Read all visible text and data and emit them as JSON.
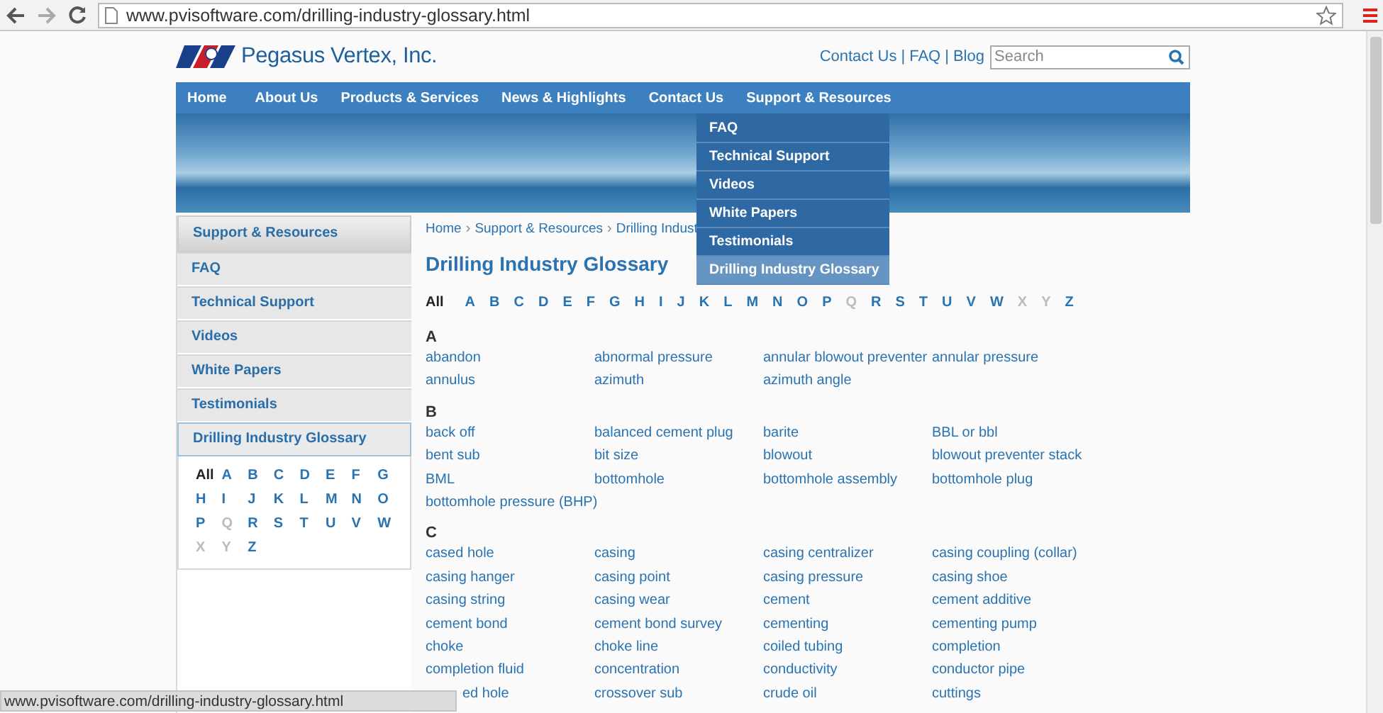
{
  "browser": {
    "url": "www.pvisoftware.com/drilling-industry-glossary.html"
  },
  "header": {
    "logo_text": "Pegasus Vertex, Inc.",
    "top_links": [
      "Contact Us",
      "FAQ",
      "Blog"
    ],
    "link_separator": "|",
    "search": {
      "placeholder": "Search"
    }
  },
  "nav": [
    "Home",
    "About Us",
    "Products & Services",
    "News & Highlights",
    "Contact Us",
    "Support & Resources"
  ],
  "dropdown": [
    {
      "label": "FAQ",
      "selected": false
    },
    {
      "label": "Technical Support",
      "selected": false
    },
    {
      "label": "Videos",
      "selected": false
    },
    {
      "label": "White Papers",
      "selected": false
    },
    {
      "label": "Testimonials",
      "selected": false
    },
    {
      "label": "Drilling Industry Glossary",
      "selected": true
    }
  ],
  "sidebar": {
    "title": "Support & Resources",
    "items": [
      {
        "label": "FAQ",
        "selected": false
      },
      {
        "label": "Technical Support",
        "selected": false
      },
      {
        "label": "Videos",
        "selected": false
      },
      {
        "label": "White Papers",
        "selected": false
      },
      {
        "label": "Testimonials",
        "selected": false
      },
      {
        "label": "Drilling Industry Glossary",
        "selected": true
      }
    ],
    "letters": [
      {
        "label": "All",
        "selected": true,
        "disabled": false
      },
      {
        "label": "A",
        "selected": false,
        "disabled": false
      },
      {
        "label": "B",
        "selected": false,
        "disabled": false
      },
      {
        "label": "C",
        "selected": false,
        "disabled": false
      },
      {
        "label": "D",
        "selected": false,
        "disabled": false
      },
      {
        "label": "E",
        "selected": false,
        "disabled": false
      },
      {
        "label": "F",
        "selected": false,
        "disabled": false
      },
      {
        "label": "G",
        "selected": false,
        "disabled": false
      },
      {
        "label": "H",
        "selected": false,
        "disabled": false
      },
      {
        "label": "I",
        "selected": false,
        "disabled": false
      },
      {
        "label": "J",
        "selected": false,
        "disabled": false
      },
      {
        "label": "K",
        "selected": false,
        "disabled": false
      },
      {
        "label": "L",
        "selected": false,
        "disabled": false
      },
      {
        "label": "M",
        "selected": false,
        "disabled": false
      },
      {
        "label": "N",
        "selected": false,
        "disabled": false
      },
      {
        "label": "O",
        "selected": false,
        "disabled": false
      },
      {
        "label": "P",
        "selected": false,
        "disabled": false
      },
      {
        "label": "Q",
        "selected": false,
        "disabled": true
      },
      {
        "label": "R",
        "selected": false,
        "disabled": false
      },
      {
        "label": "S",
        "selected": false,
        "disabled": false
      },
      {
        "label": "T",
        "selected": false,
        "disabled": false
      },
      {
        "label": "U",
        "selected": false,
        "disabled": false
      },
      {
        "label": "V",
        "selected": false,
        "disabled": false
      },
      {
        "label": "W",
        "selected": false,
        "disabled": false
      },
      {
        "label": "X",
        "selected": false,
        "disabled": true
      },
      {
        "label": "Y",
        "selected": false,
        "disabled": true
      },
      {
        "label": "Z",
        "selected": false,
        "disabled": false
      }
    ]
  },
  "breadcrumb": [
    "Home",
    "Support & Resources",
    "Drilling Indust"
  ],
  "breadcrumb_separator": "›",
  "title": "Drilling Industry Glossary",
  "letters": [
    {
      "label": "All",
      "selected": true,
      "disabled": false
    },
    {
      "label": "A",
      "selected": false,
      "disabled": false
    },
    {
      "label": "B",
      "selected": false,
      "disabled": false
    },
    {
      "label": "C",
      "selected": false,
      "disabled": false
    },
    {
      "label": "D",
      "selected": false,
      "disabled": false
    },
    {
      "label": "E",
      "selected": false,
      "disabled": false
    },
    {
      "label": "F",
      "selected": false,
      "disabled": false
    },
    {
      "label": "G",
      "selected": false,
      "disabled": false
    },
    {
      "label": "H",
      "selected": false,
      "disabled": false
    },
    {
      "label": "I",
      "selected": false,
      "disabled": false
    },
    {
      "label": "J",
      "selected": false,
      "disabled": false
    },
    {
      "label": "K",
      "selected": false,
      "disabled": false
    },
    {
      "label": "L",
      "selected": false,
      "disabled": false
    },
    {
      "label": "M",
      "selected": false,
      "disabled": false
    },
    {
      "label": "N",
      "selected": false,
      "disabled": false
    },
    {
      "label": "O",
      "selected": false,
      "disabled": false
    },
    {
      "label": "P",
      "selected": false,
      "disabled": false
    },
    {
      "label": "Q",
      "selected": false,
      "disabled": true
    },
    {
      "label": "R",
      "selected": false,
      "disabled": false
    },
    {
      "label": "S",
      "selected": false,
      "disabled": false
    },
    {
      "label": "T",
      "selected": false,
      "disabled": false
    },
    {
      "label": "U",
      "selected": false,
      "disabled": false
    },
    {
      "label": "V",
      "selected": false,
      "disabled": false
    },
    {
      "label": "W",
      "selected": false,
      "disabled": false
    },
    {
      "label": "X",
      "selected": false,
      "disabled": true
    },
    {
      "label": "Y",
      "selected": false,
      "disabled": true
    },
    {
      "label": "Z",
      "selected": false,
      "disabled": false
    }
  ],
  "sections": [
    {
      "letter": "A",
      "terms": [
        "abandon",
        "abnormal pressure",
        "annular blowout preventer",
        "annular pressure",
        "annulus",
        "azimuth",
        "azimuth angle"
      ]
    },
    {
      "letter": "B",
      "terms": [
        "back off",
        "balanced cement plug",
        "barite",
        "BBL or bbl",
        "bent sub",
        "bit size",
        "blowout",
        "blowout preventer stack",
        "BML",
        "bottomhole",
        "bottomhole assembly",
        "bottomhole plug",
        "bottomhole pressure (BHP)"
      ]
    },
    {
      "letter": "C",
      "terms": [
        "cased hole",
        "casing",
        "casing centralizer",
        "casing coupling (collar)",
        "casing hanger",
        "casing point",
        "casing pressure",
        "casing shoe",
        "casing string",
        "casing wear",
        "cement",
        "cement additive",
        "cement bond",
        "cement bond survey",
        "cementing",
        "cementing pump",
        "choke",
        "choke line",
        "coiled tubing",
        "completion",
        "completion fluid",
        "concentration",
        "conductivity",
        "conductor pipe",
        {
          "text": "ed hole",
          "clipped": true
        },
        "crossover sub",
        "crude oil",
        "cuttings"
      ]
    }
  ],
  "status_bar": {
    "text": "www.pvisoftware.com/drilling-industry-glossary.html"
  }
}
